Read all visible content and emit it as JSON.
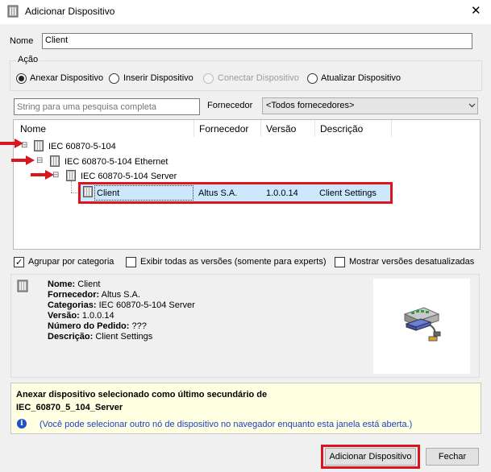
{
  "window": {
    "title": "Adicionar Dispositivo",
    "close_glyph": "✕"
  },
  "name_field": {
    "label": "Nome",
    "value": "Client"
  },
  "action_group": {
    "label": "Ação",
    "options": [
      {
        "label": "Anexar Dispositivo",
        "checked": true,
        "enabled": true
      },
      {
        "label": "Inserir Dispositivo",
        "checked": false,
        "enabled": true
      },
      {
        "label": "Conectar Dispositivo",
        "checked": false,
        "enabled": false
      },
      {
        "label": "Atualizar Dispositivo",
        "checked": false,
        "enabled": true
      }
    ]
  },
  "search": {
    "placeholder": "String para uma pesquisa completa"
  },
  "vendor_filter": {
    "label": "Fornecedor",
    "selected": "<Todos fornecedores>"
  },
  "device_tree": {
    "columns": [
      "Nome",
      "Fornecedor",
      "Versão",
      "Descrição"
    ],
    "nodes": [
      {
        "name": "IEC 60870-5-104",
        "expand_glyph": "⊟"
      },
      {
        "name": "IEC 60870-5-104 Ethernet",
        "expand_glyph": "⊟"
      },
      {
        "name": "IEC 60870-5-104 Server",
        "expand_glyph": "⊟"
      }
    ],
    "selected_row": {
      "name": "Client",
      "vendor": "Altus S.A.",
      "version": "1.0.0.14",
      "description": "Client Settings"
    }
  },
  "options": {
    "group_by_category": {
      "label": "Agrupar por categoria",
      "checked": true
    },
    "show_all_versions": {
      "label": "Exibir todas as versões (somente para experts)",
      "checked": false
    },
    "show_outdated": {
      "label": "Mostrar versões desatualizadas",
      "checked": false
    }
  },
  "details": {
    "lines": [
      {
        "key": "Nome:",
        "value": "Client"
      },
      {
        "key": "Fornecedor:",
        "value": "Altus S.A."
      },
      {
        "key": "Categorias:",
        "value": "IEC 60870-5-104 Server"
      },
      {
        "key": "Versão:",
        "value": "1.0.0.14"
      },
      {
        "key": "Número do Pedido:",
        "value": "???"
      },
      {
        "key": "Descrição:",
        "value": "Client Settings"
      }
    ],
    "image_icon": "network-device-icon"
  },
  "info_panel": {
    "line1": "Anexar dispositivo selecionado como último secundário de",
    "line2": "IEC_60870_5_104_Server",
    "note": "(Você pode selecionar outro nó de dispositivo no navegador enquanto esta janela está aberta.)",
    "info_glyph": "i"
  },
  "buttons": {
    "add": "Adicionar Dispositivo",
    "close": "Fechar"
  },
  "colors": {
    "annotation_red": "#d9151d",
    "selection_blue": "#cce8ff",
    "info_background": "#ffffe1",
    "note_blue": "#1f3fbf"
  }
}
